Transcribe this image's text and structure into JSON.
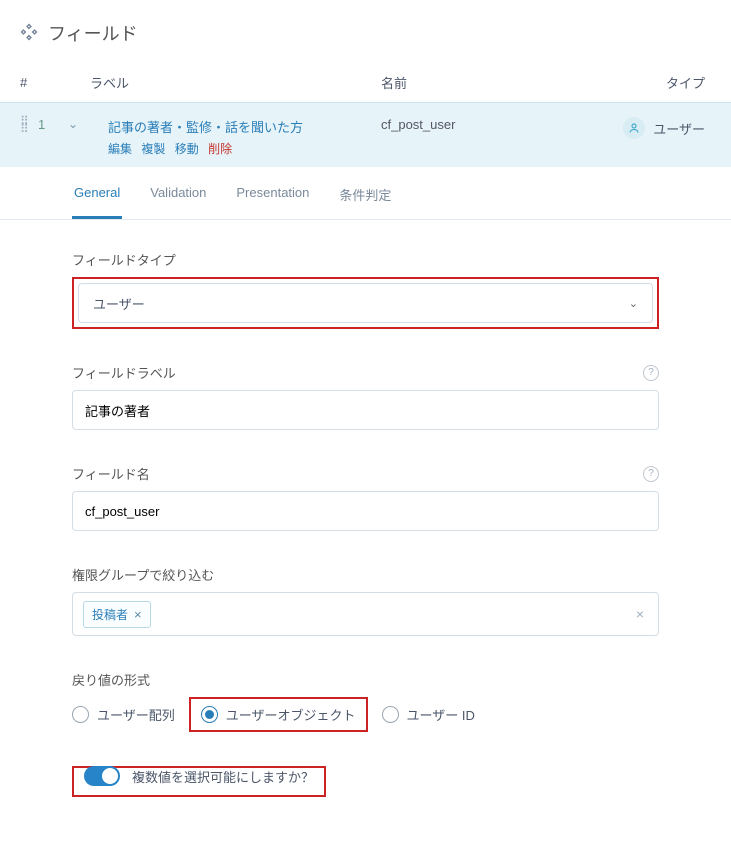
{
  "header": {
    "title": "フィールド"
  },
  "columns": {
    "num": "#",
    "label": "ラベル",
    "name": "名前",
    "type": "タイプ"
  },
  "row": {
    "num": "1",
    "title": "記事の著者・監修・話を聞いた方",
    "actions": {
      "edit": "編集",
      "duplicate": "複製",
      "move": "移動",
      "delete": "削除"
    },
    "name": "cf_post_user",
    "type": "ユーザー"
  },
  "tabs": {
    "general": "General",
    "validation": "Validation",
    "presentation": "Presentation",
    "conditional": "条件判定"
  },
  "form": {
    "fieldType": {
      "label": "フィールドタイプ",
      "value": "ユーザー"
    },
    "fieldLabel": {
      "label": "フィールドラベル",
      "value": "記事の著者"
    },
    "fieldName": {
      "label": "フィールド名",
      "value": "cf_post_user"
    },
    "roleFilter": {
      "label": "権限グループで絞り込む",
      "tag": "投稿者"
    },
    "returnFormat": {
      "label": "戻り値の形式",
      "options": {
        "array": "ユーザー配列",
        "object": "ユーザーオブジェクト",
        "id": "ユーザー ID"
      }
    },
    "multiple": {
      "label": "複数値を選択可能にしますか？"
    }
  }
}
